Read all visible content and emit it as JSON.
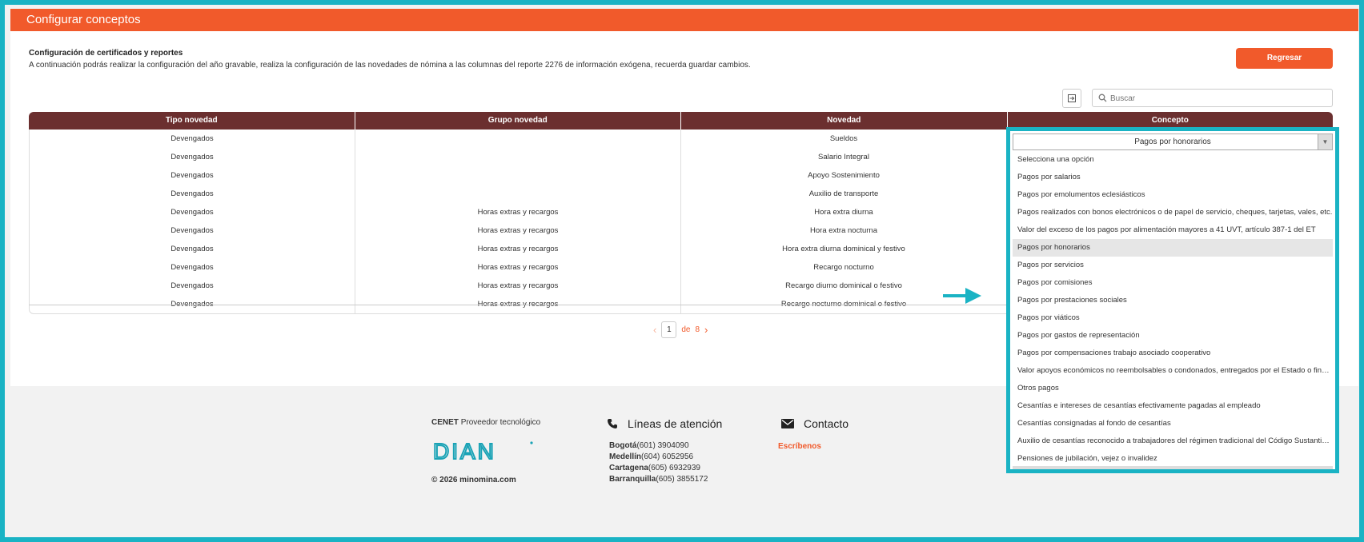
{
  "page": {
    "title": "Configurar conceptos",
    "intro_title": "Configuración de certificados y reportes",
    "intro_text": "A continuación podrás realizar la configuración del año gravable, realiza la configuración de las novedades de nómina a las columnas del reporte 2276 de información exógena, recuerda guardar cambios.",
    "back_button": "Regresar"
  },
  "toolbar": {
    "search_placeholder": "Buscar",
    "export_icon": "export-icon",
    "search_icon": "search-icon"
  },
  "table": {
    "headers": [
      "Tipo novedad",
      "Grupo novedad",
      "Novedad",
      "Concepto"
    ],
    "rows": [
      [
        "Devengados",
        "",
        "Sueldos",
        ""
      ],
      [
        "Devengados",
        "",
        "Salario Integral",
        ""
      ],
      [
        "Devengados",
        "",
        "Apoyo Sostenimiento",
        ""
      ],
      [
        "Devengados",
        "",
        "Auxilio de transporte",
        ""
      ],
      [
        "Devengados",
        "Horas extras y recargos",
        "Hora extra diurna",
        ""
      ],
      [
        "Devengados",
        "Horas extras y recargos",
        "Hora extra nocturna",
        ""
      ],
      [
        "Devengados",
        "Horas extras y recargos",
        "Hora extra diurna dominical y festivo",
        ""
      ],
      [
        "Devengados",
        "Horas extras y recargos",
        "Recargo nocturno",
        ""
      ],
      [
        "Devengados",
        "Horas extras y recargos",
        "Recargo diurno dominical o festivo",
        ""
      ],
      [
        "Devengados",
        "Horas extras y recargos",
        "Recargo nocturno dominical o festivo",
        ""
      ]
    ]
  },
  "pagination": {
    "current": "1",
    "of_label": "de",
    "total": "8"
  },
  "dropdown": {
    "selected": "Pagos por honorarios",
    "options": [
      "Selecciona una opción",
      "Pagos por salarios",
      "Pagos por emolumentos eclesiásticos",
      "Pagos realizados con bonos electrónicos o de papel de servicio, cheques, tarjetas, vales, etc.",
      "Valor del exceso de los pagos por alimentación mayores a 41 UVT, artículo 387-1 del ET",
      "Pagos por honorarios",
      "Pagos por servicios",
      "Pagos por comisiones",
      "Pagos por prestaciones sociales",
      "Pagos por viáticos",
      "Pagos por gastos de representación",
      "Pagos por compensaciones trabajo asociado cooperativo",
      "Valor apoyos económicos no reembolsables o condonados, entregados por el Estado o financiados con recursos públicos",
      "Otros pagos",
      "Cesantías e intereses de cesantías efectivamente pagadas al empleado",
      "Cesantías consignadas al fondo de cesantías",
      "Auxilio de cesantías reconocido a trabajadores del régimen tradicional del Código Sustantivo del Trabajo",
      "Pensiones de jubilación, vejez o invalidez"
    ],
    "selected_index": 5
  },
  "footer": {
    "cenet_brand": "CENET",
    "cenet_text": "Proveedor tecnológico",
    "dian_logo": "DIAN",
    "copyright": "© 2026 minomina.com",
    "lines_title": "Líneas de atención",
    "lines": [
      {
        "city": "Bogotá",
        "phone": "(601) 3904090"
      },
      {
        "city": "Medellín",
        "phone": "(604) 6052956"
      },
      {
        "city": "Cartagena",
        "phone": "(605) 6932939"
      },
      {
        "city": "Barranquilla",
        "phone": "(605) 3855172"
      }
    ],
    "contact_title": "Contacto",
    "contact_link": "Escríbenos"
  },
  "colors": {
    "brand_orange": "#f15a2b",
    "header_brown": "#6b2f2f",
    "highlight_cyan": "#1ab3c4"
  }
}
